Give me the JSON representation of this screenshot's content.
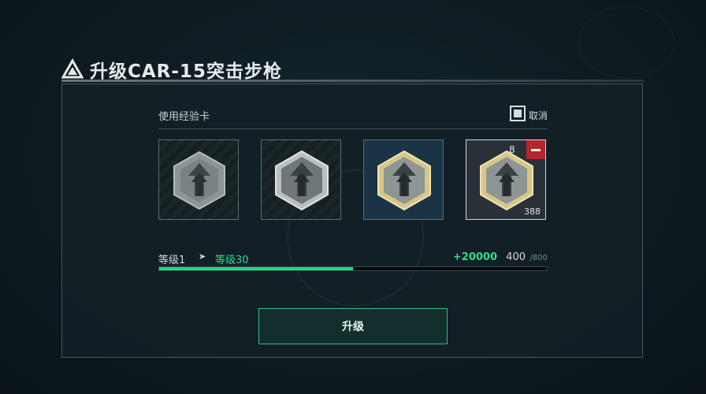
{
  "title": "升级CAR-15突击步枪",
  "section": {
    "label": "使用经验卡"
  },
  "cancel": {
    "label": "取消",
    "checked": false
  },
  "cards": [
    {
      "tier": "silver",
      "count": "",
      "selected": ""
    },
    {
      "tier": "silver-framed",
      "count": "",
      "selected": ""
    },
    {
      "tier": "gold",
      "count": "",
      "selected": ""
    },
    {
      "tier": "gold",
      "count": "388",
      "selected": "8"
    }
  ],
  "level": {
    "from": "等级1",
    "arrow": "➤",
    "to": "等级30",
    "xp_gain": "+20000",
    "xp_current": "400",
    "xp_max": "/800",
    "progress_fraction": 0.5
  },
  "upgrade_button": {
    "label": "升级"
  },
  "colors": {
    "accent_green": "#20d988",
    "remove_red": "#b3262b"
  },
  "icons": [
    "title-logo-icon",
    "exp-card-icon",
    "minus-icon"
  ]
}
